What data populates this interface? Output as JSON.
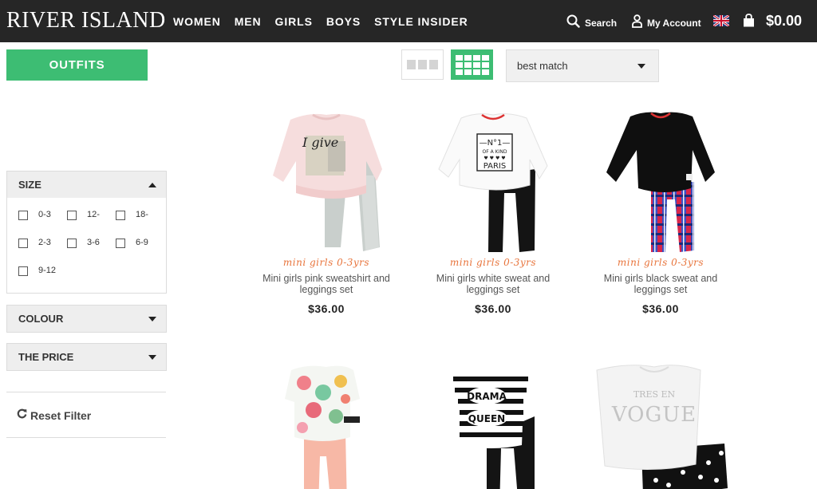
{
  "header": {
    "brand": "RIVER ISLAND",
    "nav": [
      "WOMEN",
      "MEN",
      "GIRLS",
      "BOYS",
      "STYLE INSIDER"
    ],
    "search_label": "Search",
    "account_label": "My Account",
    "bag_total": "$0.00"
  },
  "sidebar": {
    "outfits_label": "OUTFITS",
    "filters": {
      "size": {
        "title": "SIZE",
        "options": [
          "0-3",
          "12-",
          "18-",
          "2-3",
          "3-6",
          "6-9",
          "9-12"
        ]
      },
      "colour": {
        "title": "COLOUR"
      },
      "price": {
        "title": "THE PRICE"
      }
    },
    "reset_label": "Reset Filter"
  },
  "sort": {
    "selected": "best match"
  },
  "products": [
    {
      "category": "mini girls 0-3yrs",
      "name": "Mini girls pink sweatshirt and leggings set",
      "price": "$36.00"
    },
    {
      "category": "mini girls 0-3yrs",
      "name": "Mini girls white sweat and leggings set",
      "price": "$36.00"
    },
    {
      "category": "mini girls 0-3yrs",
      "name": "Mini girls black sweat and leggings set",
      "price": "$36.00"
    }
  ],
  "product_art": {
    "p1_print": "I give",
    "p2_print": [
      "—N°1—",
      "OF A KIND",
      "♥ ♥ ♥ ♥",
      "PARIS"
    ],
    "p5_print": [
      "DRAMA",
      "QUEEN"
    ],
    "p6_print": [
      "TRES EN",
      "VOGUE"
    ]
  },
  "colors": {
    "header_bg": "#262626",
    "accent_green": "#3dbd73",
    "category_orange": "#e8743b"
  }
}
